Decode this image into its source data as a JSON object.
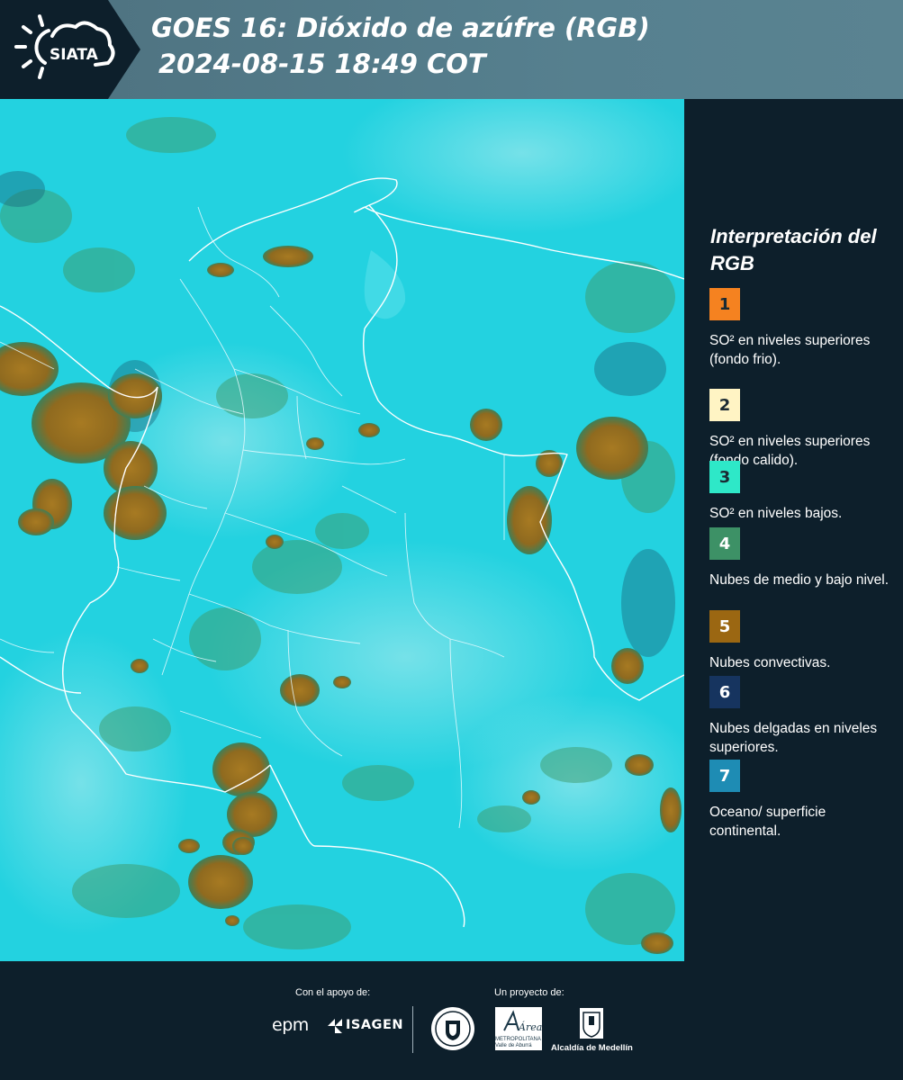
{
  "header": {
    "title_line1": "GOES 16: Dióxido de azúfre (RGB)",
    "title_line2": "2024-08-15 18:49 COT",
    "logo_text": "SIATA"
  },
  "map": {
    "background_color": "#22d3e2",
    "cloud_color": "#9a7222",
    "border_color": "#ffffff"
  },
  "legend": {
    "title": "Interpretación del RGB",
    "items": [
      {
        "number": "1",
        "color": "#f58220",
        "text_color": "#1b2a33",
        "label": "SO² en niveles superiores (fondo frio)."
      },
      {
        "number": "2",
        "color": "#fff4c4",
        "text_color": "#1b2a33",
        "label": "SO² en niveles superiores (fondo calido)."
      },
      {
        "number": "3",
        "color": "#2ee8c8",
        "text_color": "#1b2a33",
        "label": "SO² en niveles bajos."
      },
      {
        "number": "4",
        "color": "#3d9166",
        "text_color": "#ffffff",
        "label": "Nubes de medio y bajo nivel."
      },
      {
        "number": "5",
        "color": "#9b6712",
        "text_color": "#ffffff",
        "label": "Nubes convectivas."
      },
      {
        "number": "6",
        "color": "#16345f",
        "text_color": "#ffffff",
        "label": "Nubes delgadas en niveles superiores."
      },
      {
        "number": "7",
        "color": "#1e8cb4",
        "text_color": "#ffffff",
        "label": "Oceano/ superficie continental."
      }
    ]
  },
  "footer": {
    "support_label": "Con el apoyo de:",
    "project_label": "Un proyecto de:",
    "epm": "epm",
    "isagen": "ISAGEN",
    "area_name": "METROPOLITANA Valle de Aburrá",
    "area_logo_text": "Área",
    "alcaldia": "Alcaldía de Medellín"
  }
}
